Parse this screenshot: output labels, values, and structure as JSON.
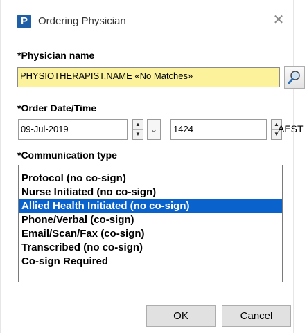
{
  "window": {
    "app_icon_letter": "P",
    "title": "Ordering Physician",
    "close_glyph": "✕"
  },
  "physician": {
    "label": "*Physician name",
    "value": "PHYSIOTHERAPIST,NAME   «No Matches»",
    "field_bg": "#fbf29b"
  },
  "order": {
    "label": "*Order Date/Time",
    "date": "09-Jul-2019",
    "time": "1424",
    "timezone": "AEST"
  },
  "communication": {
    "label": "*Communication type",
    "selected_index": 2,
    "selected_color": "#0a63cc",
    "items": [
      "Protocol (no co-sign)",
      "Nurse Initiated (no co-sign)",
      "Allied Health Initiated (no co-sign)",
      "Phone/Verbal (co-sign)",
      "Email/Scan/Fax (co-sign)",
      "Transcribed (no co-sign)",
      "Co-sign Required"
    ]
  },
  "buttons": {
    "ok": "OK",
    "cancel": "Cancel"
  },
  "icons": {
    "search": "magnifier-icon",
    "spin_up": "▲",
    "spin_down": "▼",
    "dropdown": "⌄"
  }
}
